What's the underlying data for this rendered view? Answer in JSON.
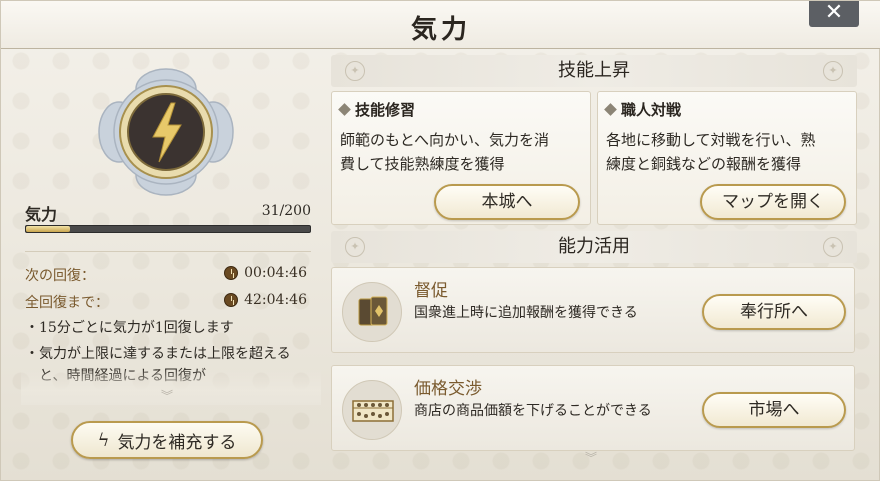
{
  "window": {
    "title": "気力",
    "close_glyph": "✕"
  },
  "stamina": {
    "label": "気力",
    "value_text": "31/200",
    "fill_fraction": 0.155,
    "next_recovery_label": "次の回復：",
    "next_recovery_time": "00:04:46",
    "full_recovery_label": "全回復まで：",
    "full_recovery_time": "42:04:46",
    "notes": [
      "・15分ごとに気力が1回復します",
      "・気力が上限に達するまたは上限を超えると、時間経過による回復が"
    ],
    "refill_button": "気力を補充する"
  },
  "skill_section": {
    "heading": "技能上昇",
    "cards": [
      {
        "title": "技能修習",
        "desc_line1": "師範のもとへ向かい、気力を消",
        "desc_line2": "費して技能熟練度を獲得",
        "button": "本城へ"
      },
      {
        "title": "職人対戦",
        "desc_line1": "各地に移動して対戦を行い、熟",
        "desc_line2": "練度と銅銭などの報酬を獲得",
        "button": "マップを開く"
      }
    ]
  },
  "ability_section": {
    "heading": "能力活用",
    "items": [
      {
        "title": "督促",
        "desc": "国衆進上時に追加報酬を獲得できる",
        "button": "奉行所へ",
        "icon": "tokens-icon"
      },
      {
        "title": "価格交渉",
        "desc": "商店の商品価額を下げることができる",
        "button": "市場へ",
        "icon": "abacus-icon"
      }
    ]
  },
  "colors": {
    "accent_gold": "#b99a4e",
    "label_brown": "#7a5a2e",
    "bar_fill": "#d9bf6e"
  }
}
